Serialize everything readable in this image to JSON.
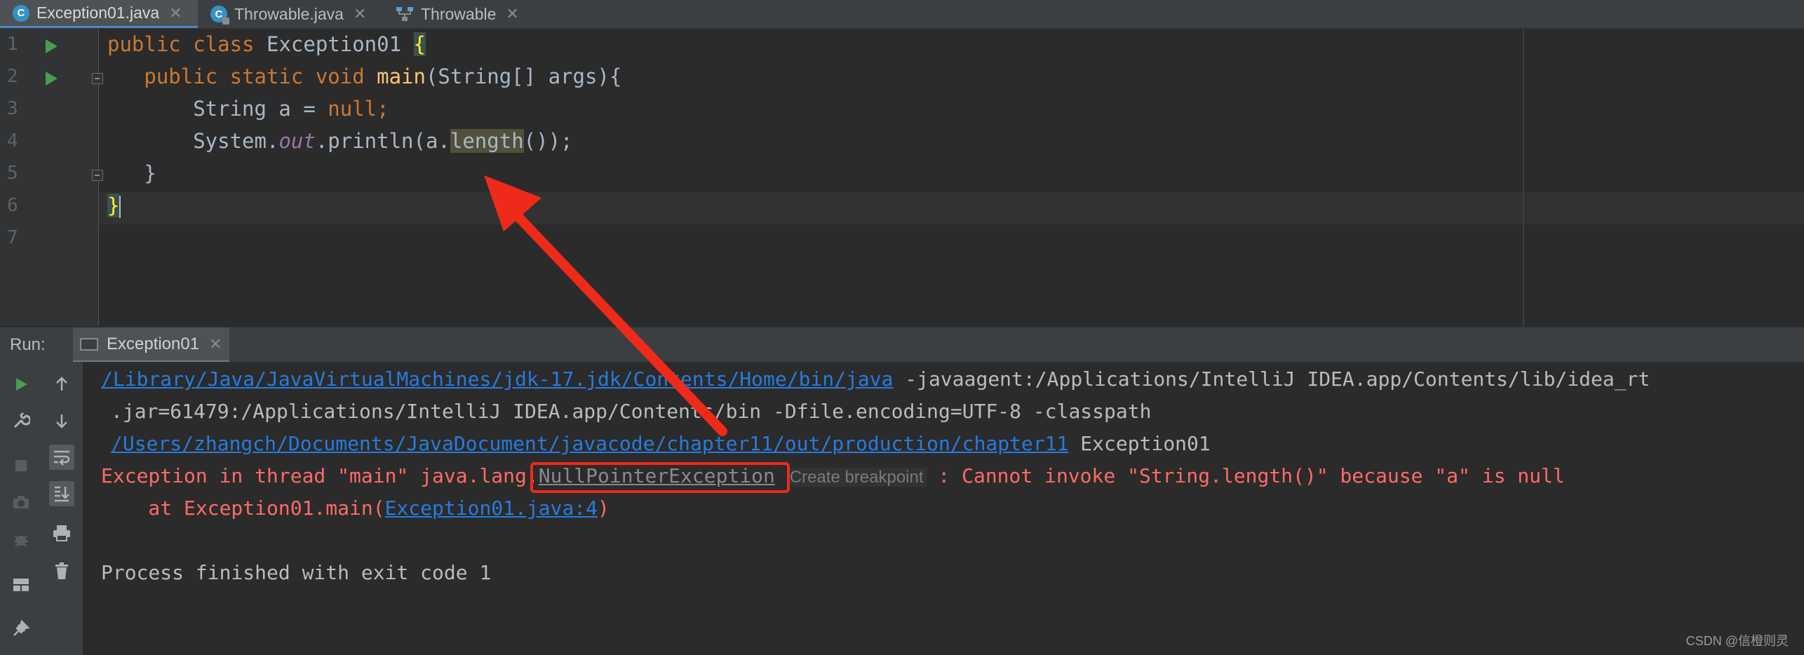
{
  "tabs": [
    {
      "label": "Exception01.java",
      "icon": "class-icon",
      "active": true
    },
    {
      "label": "Throwable.java",
      "icon": "class-locked-icon",
      "active": false
    },
    {
      "label": "Throwable",
      "icon": "hierarchy-icon",
      "active": false
    }
  ],
  "tab_close_glyph": "✕",
  "editor": {
    "line_numbers": [
      "1",
      "2",
      "3",
      "4",
      "5",
      "6",
      "7"
    ],
    "line1": {
      "kw1": "public class ",
      "name": "Exception01 ",
      "brace": "{"
    },
    "line2": {
      "kw": "public static void ",
      "fn": "main",
      "rest": "(String[] args){"
    },
    "line3": {
      "type": "String a = ",
      "kw": "null",
      "semi": ";"
    },
    "line4": {
      "pre": "System.",
      "static": "out",
      "mid": ".println(a.",
      "call": "length",
      "post": "());"
    },
    "line5": {
      "text": "}"
    },
    "line6": {
      "brace": "}"
    }
  },
  "run": {
    "label": "Run:",
    "tab_label": "Exception01",
    "console": {
      "l1_link": "/Library/Java/JavaVirtualMachines/jdk-17.jdk/Contents/Home/bin/java",
      "l1_rest": " -javaagent:/Applications/IntelliJ IDEA.app/Contents/lib/idea_rt",
      "l2": ".jar=61479:/Applications/IntelliJ IDEA.app/Contents/bin -Dfile.encoding=UTF-8 -classpath",
      "l3_link": "/Users/zhangch/Documents/JavaDocument/javacode/chapter11/out/production/chapter11",
      "l3_rest": " Exception01",
      "l4_pre": "Exception in thread \"main\" java.lang.",
      "l4_exc": "NullPointerException",
      "l4_bp": "Create breakpoint",
      "l4_post": " : Cannot invoke \"String.length()\" because \"a\" is null",
      "l5_pre": "    at Exception01.main(",
      "l5_link": "Exception01.java:4",
      "l5_post": ")",
      "l6": "Process finished with exit code 1"
    }
  },
  "toolbar_icons": [
    "rerun-icon",
    "up-arrow-icon",
    "wrench-icon",
    "down-arrow-icon",
    "stop-icon",
    "soft-wrap-icon",
    "camera-icon",
    "scroll-to-end-icon",
    "settings-bug-icon",
    "print-icon",
    "layout-icon",
    "trash-icon",
    "pin-icon"
  ],
  "watermark": "CSDN @信橙则灵",
  "colors": {
    "keyword": "#cc7832",
    "method": "#ffc66d",
    "error": "#ff6b68",
    "link": "#287bde",
    "annotation_red": "#ee2a1a"
  }
}
